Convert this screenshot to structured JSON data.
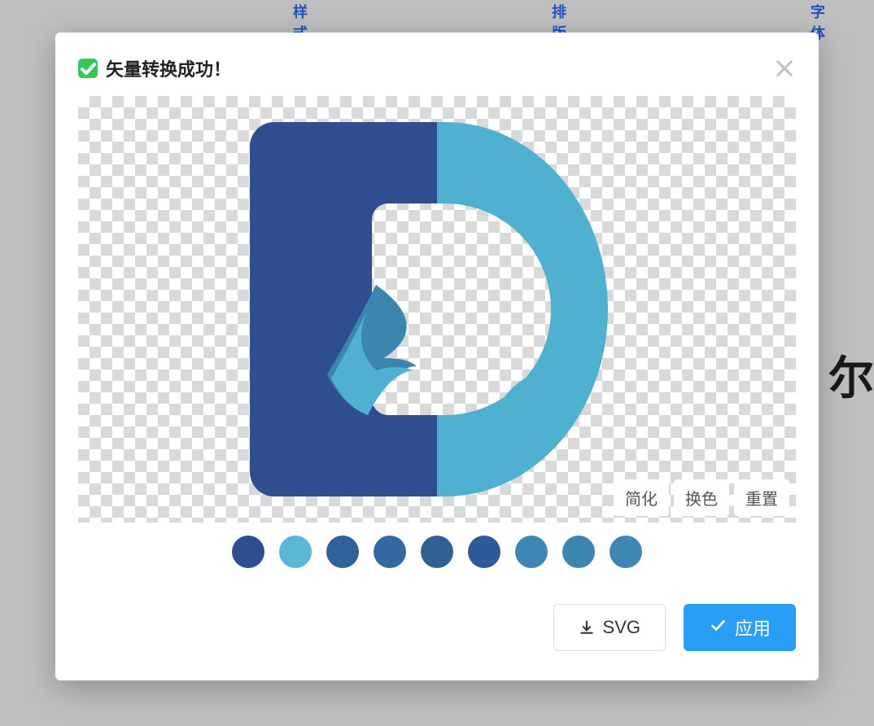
{
  "background": {
    "tabs": [
      "换样式",
      "换排版",
      "换字体"
    ],
    "side_glyph": "尔"
  },
  "modal": {
    "title": "矢量转换成功！",
    "preview_actions": {
      "simplify": "简化",
      "recolor": "换色",
      "reset": "重置"
    },
    "swatches": [
      "#2f4e8f",
      "#5ab8d6",
      "#30619a",
      "#3568a1",
      "#316095",
      "#2e5a9a",
      "#3e87b4",
      "#3c85ae",
      "#3f86b2"
    ],
    "buttons": {
      "download": "SVG",
      "apply": "应用"
    },
    "logo_colors": {
      "left": "#2f4e8f",
      "right": "#4fb0d0",
      "accent": "#3c85ae"
    }
  }
}
